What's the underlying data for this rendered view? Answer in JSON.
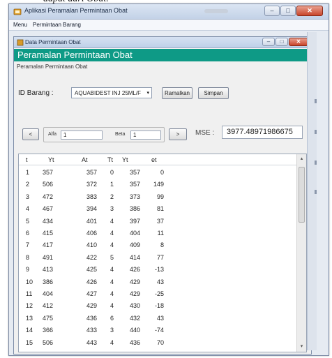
{
  "outer_window": {
    "title": "Aplikasi Peramalan Permintaan Obat",
    "menu": [
      "Menu",
      "Permintaan Barang"
    ]
  },
  "child_window": {
    "title": "Data Permintaan Obat",
    "header": "Peramalan Permintaan Obat",
    "subtitle": "Peramalan Permintaan Obat"
  },
  "form": {
    "id_label": "ID Barang :",
    "id_value": "AQUABIDEST INJ 25ML/F",
    "ramalkan_label": "Ramalkan",
    "simpan_label": "Simpan"
  },
  "params": {
    "prev_label": "<",
    "next_label": ">",
    "alfa_label": "Alfa",
    "alfa_value": "1",
    "beta_label": "Beta",
    "beta_value": "1",
    "mse_label": "MSE :",
    "mse_value": "3977.48971986675"
  },
  "table": {
    "columns": [
      "t",
      "Yt",
      "At",
      "Tt",
      "Yt",
      "et"
    ],
    "rows": [
      [
        "1",
        "357",
        "357",
        "0",
        "357",
        "0"
      ],
      [
        "2",
        "506",
        "372",
        "1",
        "357",
        "149"
      ],
      [
        "3",
        "472",
        "383",
        "2",
        "373",
        "99"
      ],
      [
        "4",
        "467",
        "394",
        "3",
        "386",
        "81"
      ],
      [
        "5",
        "434",
        "401",
        "4",
        "397",
        "37"
      ],
      [
        "6",
        "415",
        "406",
        "4",
        "404",
        "11"
      ],
      [
        "7",
        "417",
        "410",
        "4",
        "409",
        "8"
      ],
      [
        "8",
        "491",
        "422",
        "5",
        "414",
        "77"
      ],
      [
        "9",
        "413",
        "425",
        "4",
        "426",
        "-13"
      ],
      [
        "10",
        "386",
        "426",
        "4",
        "429",
        "43"
      ],
      [
        "11",
        "404",
        "427",
        "4",
        "429",
        "-25"
      ],
      [
        "12",
        "412",
        "429",
        "4",
        "430",
        "-18"
      ],
      [
        "13",
        "475",
        "436",
        "6",
        "432",
        "43"
      ],
      [
        "14",
        "366",
        "433",
        "3",
        "440",
        "-74"
      ],
      [
        "15",
        "506",
        "443",
        "4",
        "436",
        "70"
      ]
    ]
  },
  "window_controls": {
    "minimize": "–",
    "maximize": "□",
    "close": "✕"
  },
  "icons": {
    "combo_arrow": "▾",
    "scroll_up": "▴",
    "scroll_down": "▾"
  },
  "colors": {
    "header_band": "#0e9a86",
    "close_button": "#c9452b"
  }
}
